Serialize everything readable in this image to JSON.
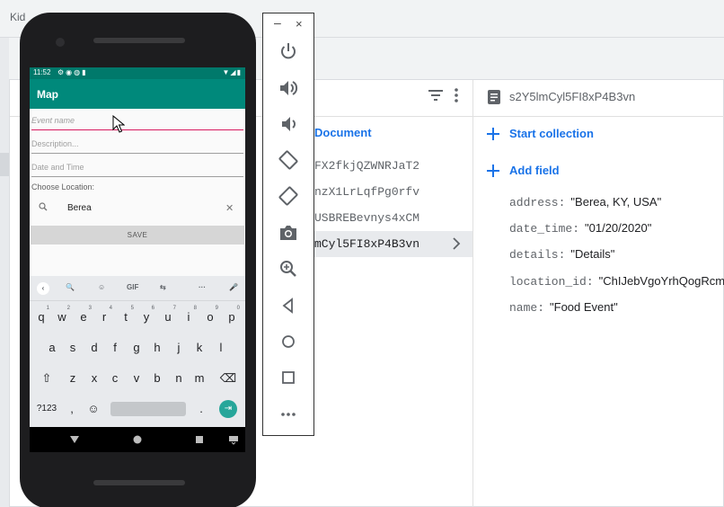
{
  "app": {
    "title": "Kid"
  },
  "firestore": {
    "add_document_label": "Document",
    "documents": [
      "FX2fkjQZWNRJaT2",
      "nzX1LrLqfPg0rfv",
      "USBREBevnys4xCM",
      "mCyl5FI8xP4B3vn"
    ],
    "selected_document_id": "s2Y5lmCyl5FI8xP4B3vn",
    "start_collection_label": "Start collection",
    "add_field_label": "Add field",
    "fields": [
      {
        "key": "address:",
        "value": "\"Berea, KY, USA\""
      },
      {
        "key": "date_time:",
        "value": "\"01/20/2020\""
      },
      {
        "key": "details:",
        "value": "\"Details\""
      },
      {
        "key": "location_id:",
        "value": "\"ChIJebVgoYrhQogRcmY"
      },
      {
        "key": "name:",
        "value": "\"Food Event\""
      }
    ]
  },
  "emulator_toolbar": {
    "minimize": "–",
    "close": "×",
    "buttons": [
      "power-icon",
      "volume-up-icon",
      "volume-down-icon",
      "rotate-left-icon",
      "rotate-right-icon",
      "camera-icon",
      "zoom-in-icon",
      "back-icon",
      "home-icon",
      "overview-icon",
      "more-icon"
    ]
  },
  "phone": {
    "status_time": "11:52",
    "appbar_title": "Map",
    "event_name_placeholder": "Event name",
    "description_placeholder": "Description...",
    "date_time_placeholder": "Date and Time",
    "choose_location_label": "Choose Location:",
    "location_value": "Berea",
    "clear_symbol": "✕",
    "save_label": "SAVE",
    "keyboard": {
      "toolbar": [
        "‹",
        "🔍",
        "☺",
        "GIF",
        "⇆",
        "···",
        "🎤"
      ],
      "row1": [
        "q",
        "w",
        "e",
        "r",
        "t",
        "y",
        "u",
        "i",
        "o",
        "p"
      ],
      "row1_sup": [
        "1",
        "2",
        "3",
        "4",
        "5",
        "6",
        "7",
        "8",
        "9",
        "0"
      ],
      "row2": [
        "a",
        "s",
        "d",
        "f",
        "g",
        "h",
        "j",
        "k",
        "l"
      ],
      "row3": [
        "⇧",
        "z",
        "x",
        "c",
        "v",
        "b",
        "n",
        "m",
        "⌫"
      ],
      "sym_label": "?123",
      "comma": ",",
      "emoji": "☺",
      "period": "."
    }
  },
  "colors": {
    "accent": "#1a73e8",
    "app_bar": "#00897b",
    "status_bar": "#00796b",
    "focus_line": "#d81b60"
  }
}
